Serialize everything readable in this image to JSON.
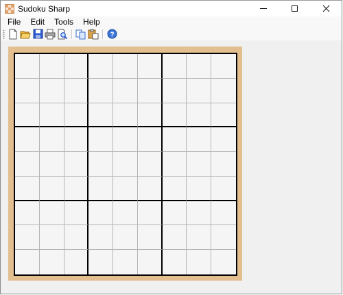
{
  "window": {
    "title": "Sudoku Sharp"
  },
  "menu": {
    "items": [
      "File",
      "Edit",
      "Tools",
      "Help"
    ]
  },
  "toolbar": {
    "buttons": [
      {
        "icon": "new-document-icon"
      },
      {
        "icon": "open-folder-icon"
      },
      {
        "icon": "save-icon"
      },
      {
        "icon": "print-icon"
      },
      {
        "icon": "print-preview-icon"
      },
      {
        "icon": "copy-icon"
      },
      {
        "icon": "paste-icon"
      },
      {
        "icon": "help-icon"
      }
    ]
  },
  "board": {
    "rows": 9,
    "cols": 9,
    "cells": [
      [
        "",
        "",
        "",
        "",
        "",
        "",
        "",
        "",
        ""
      ],
      [
        "",
        "",
        "",
        "",
        "",
        "",
        "",
        "",
        ""
      ],
      [
        "",
        "",
        "",
        "",
        "",
        "",
        "",
        "",
        ""
      ],
      [
        "",
        "",
        "",
        "",
        "",
        "",
        "",
        "",
        ""
      ],
      [
        "",
        "",
        "",
        "",
        "",
        "",
        "",
        "",
        ""
      ],
      [
        "",
        "",
        "",
        "",
        "",
        "",
        "",
        "",
        ""
      ],
      [
        "",
        "",
        "",
        "",
        "",
        "",
        "",
        "",
        ""
      ],
      [
        "",
        "",
        "",
        "",
        "",
        "",
        "",
        "",
        ""
      ],
      [
        "",
        "",
        "",
        "",
        "",
        "",
        "",
        "",
        ""
      ]
    ]
  },
  "colors": {
    "board_frame": "#e3bf90",
    "cell_background": "#f5f5f5",
    "thin_line": "#b5b5b5",
    "box_line": "#000000"
  }
}
